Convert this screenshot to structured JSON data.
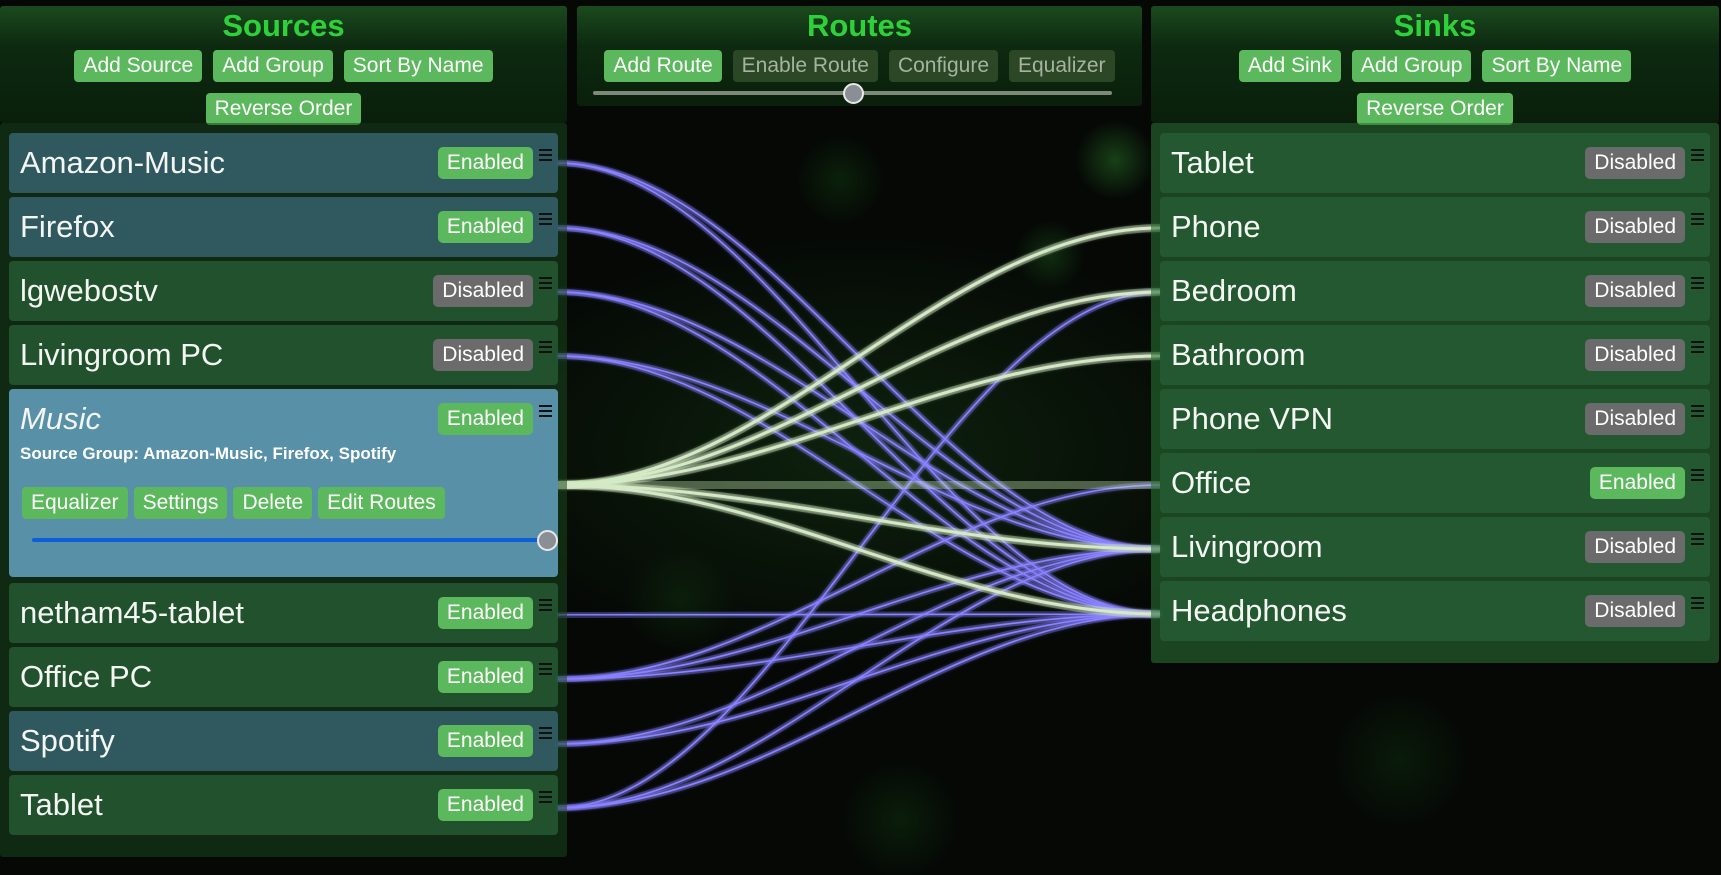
{
  "sources": {
    "title": "Sources",
    "buttons": [
      "Add Source",
      "Add Group",
      "Sort By Name",
      "Reverse Order"
    ],
    "items": [
      {
        "name": "Amazon-Music",
        "status": "Enabled",
        "selected": true
      },
      {
        "name": "Firefox",
        "status": "Enabled",
        "selected": true
      },
      {
        "name": "lgwebostv",
        "status": "Disabled",
        "selected": false
      },
      {
        "name": "Livingroom PC",
        "status": "Disabled",
        "selected": false
      },
      {
        "name": "Music",
        "status": "Enabled",
        "selected": true,
        "group": true,
        "subtitle": "Source Group: Amazon-Music, Firefox, Spotify",
        "actions": [
          "Equalizer",
          "Settings",
          "Delete",
          "Edit Routes"
        ],
        "volume": 1.0
      },
      {
        "name": "netham45-tablet",
        "status": "Enabled",
        "selected": false
      },
      {
        "name": "Office PC",
        "status": "Enabled",
        "selected": false
      },
      {
        "name": "Spotify",
        "status": "Enabled",
        "selected": true
      },
      {
        "name": "Tablet",
        "status": "Enabled",
        "selected": false
      }
    ]
  },
  "routes": {
    "title": "Routes",
    "buttons": [
      {
        "label": "Add Route",
        "enabled": true
      },
      {
        "label": "Enable Route",
        "enabled": false
      },
      {
        "label": "Configure",
        "enabled": false
      },
      {
        "label": "Equalizer",
        "enabled": false
      }
    ],
    "slider_value": 0.5
  },
  "sinks": {
    "title": "Sinks",
    "buttons": [
      "Add Sink",
      "Add Group",
      "Sort By Name",
      "Reverse Order"
    ],
    "items": [
      {
        "name": "Tablet",
        "status": "Disabled"
      },
      {
        "name": "Phone",
        "status": "Disabled"
      },
      {
        "name": "Bedroom",
        "status": "Disabled"
      },
      {
        "name": "Bathroom",
        "status": "Disabled"
      },
      {
        "name": "Phone VPN",
        "status": "Disabled"
      },
      {
        "name": "Office",
        "status": "Enabled"
      },
      {
        "name": "Livingroom",
        "status": "Disabled"
      },
      {
        "name": "Headphones",
        "status": "Disabled"
      }
    ]
  },
  "connections": [
    {
      "source": 0,
      "sink": 6,
      "kind": "route"
    },
    {
      "source": 0,
      "sink": 7,
      "kind": "route"
    },
    {
      "source": 1,
      "sink": 6,
      "kind": "route"
    },
    {
      "source": 1,
      "sink": 7,
      "kind": "route"
    },
    {
      "source": 2,
      "sink": 6,
      "kind": "route"
    },
    {
      "source": 2,
      "sink": 7,
      "kind": "route"
    },
    {
      "source": 3,
      "sink": 6,
      "kind": "route"
    },
    {
      "source": 3,
      "sink": 7,
      "kind": "route"
    },
    {
      "source": 4,
      "sink": 1,
      "kind": "group"
    },
    {
      "source": 4,
      "sink": 2,
      "kind": "group"
    },
    {
      "source": 4,
      "sink": 3,
      "kind": "group"
    },
    {
      "source": 4,
      "sink": 5,
      "kind": "group"
    },
    {
      "source": 4,
      "sink": 6,
      "kind": "group"
    },
    {
      "source": 4,
      "sink": 7,
      "kind": "group"
    },
    {
      "source": 5,
      "sink": 7,
      "kind": "route"
    },
    {
      "source": 6,
      "sink": 5,
      "kind": "route"
    },
    {
      "source": 6,
      "sink": 6,
      "kind": "route"
    },
    {
      "source": 6,
      "sink": 7,
      "kind": "route"
    },
    {
      "source": 7,
      "sink": 6,
      "kind": "route"
    },
    {
      "source": 7,
      "sink": 7,
      "kind": "route"
    },
    {
      "source": 8,
      "sink": 2,
      "kind": "route"
    },
    {
      "source": 8,
      "sink": 6,
      "kind": "route"
    },
    {
      "source": 8,
      "sink": 7,
      "kind": "route"
    }
  ],
  "colors": {
    "accent": "#5cb85c",
    "title": "#2fd13a",
    "route_line": "#8b84ff",
    "group_line": "#d6e8c8",
    "disabled": "#6b6b6b",
    "group_bg": "#5890a8"
  }
}
